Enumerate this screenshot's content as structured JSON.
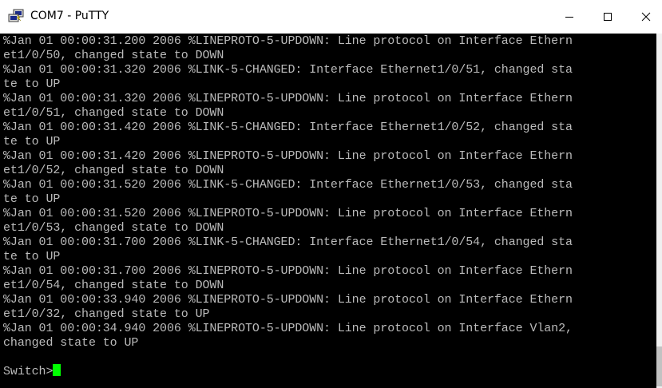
{
  "window": {
    "title": "COM7 - PuTTY",
    "icons": {
      "app": "putty-computer-icon",
      "minimize": "minimize-icon",
      "maximize": "maximize-icon",
      "close": "close-icon"
    }
  },
  "terminal": {
    "lines": [
      "%Jan 01 00:00:31.200 2006 %LINEPROTO-5-UPDOWN: Line protocol on Interface Ethern",
      "et1/0/50, changed state to DOWN",
      "%Jan 01 00:00:31.320 2006 %LINK-5-CHANGED: Interface Ethernet1/0/51, changed sta",
      "te to UP",
      "%Jan 01 00:00:31.320 2006 %LINEPROTO-5-UPDOWN: Line protocol on Interface Ethern",
      "et1/0/51, changed state to DOWN",
      "%Jan 01 00:00:31.420 2006 %LINK-5-CHANGED: Interface Ethernet1/0/52, changed sta",
      "te to UP",
      "%Jan 01 00:00:31.420 2006 %LINEPROTO-5-UPDOWN: Line protocol on Interface Ethern",
      "et1/0/52, changed state to DOWN",
      "%Jan 01 00:00:31.520 2006 %LINK-5-CHANGED: Interface Ethernet1/0/53, changed sta",
      "te to UP",
      "%Jan 01 00:00:31.520 2006 %LINEPROTO-5-UPDOWN: Line protocol on Interface Ethern",
      "et1/0/53, changed state to DOWN",
      "%Jan 01 00:00:31.700 2006 %LINK-5-CHANGED: Interface Ethernet1/0/54, changed sta",
      "te to UP",
      "%Jan 01 00:00:31.700 2006 %LINEPROTO-5-UPDOWN: Line protocol on Interface Ethern",
      "et1/0/54, changed state to DOWN",
      "%Jan 01 00:00:33.940 2006 %LINEPROTO-5-UPDOWN: Line protocol on Interface Ethern",
      "et1/0/32, changed state to UP",
      "%Jan 01 00:00:34.940 2006 %LINEPROTO-5-UPDOWN: Line protocol on Interface Vlan2,",
      "changed state to UP",
      "",
      "Switch>"
    ]
  },
  "colors": {
    "background": "#000000",
    "text": "#bbbbbb",
    "cursor": "#00ff00"
  }
}
